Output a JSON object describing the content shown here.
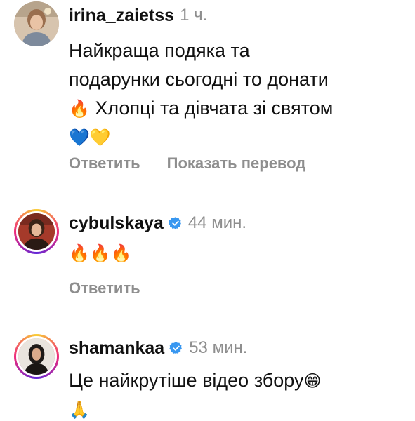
{
  "colors": {
    "text": "#111111",
    "muted": "#8e8e8e",
    "verified": "#3897f0",
    "story_ring_start": "#f9ce34",
    "story_ring_mid": "#ee2a7b",
    "story_ring_end": "#6228d7"
  },
  "comments": [
    {
      "username": "irina_zaietss",
      "time": "1 ч.",
      "verified": false,
      "avatar_icon": "avatar-photo-icon",
      "lines": [
        {
          "text": "Найкраща подяка та"
        },
        {
          "text": "подарунки сьогодні то донати"
        },
        {
          "emoji": "🔥",
          "text": " Хлопці та дівчата зі святом"
        },
        {
          "emoji": "💙💛"
        }
      ],
      "actions": [
        "Ответить",
        "Показать перевод"
      ]
    },
    {
      "username": "cybulskaya",
      "time": "44 мин.",
      "verified": true,
      "avatar_icon": "avatar-photo-icon",
      "lines": [
        {
          "emoji": "🔥🔥🔥"
        }
      ],
      "actions": [
        "Ответить"
      ]
    },
    {
      "username": "shamankaa",
      "time": "53 мин.",
      "verified": true,
      "avatar_icon": "avatar-photo-icon",
      "lines": [
        {
          "text": "Це найкрутіше відео збору",
          "emoji_after": "😁"
        },
        {
          "emoji": "🙏"
        }
      ],
      "actions": []
    }
  ]
}
